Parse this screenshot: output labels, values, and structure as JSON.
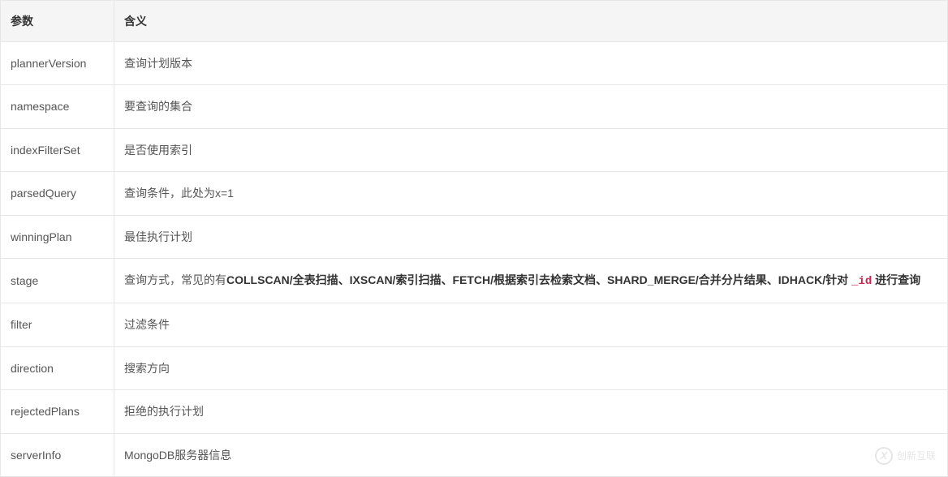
{
  "table": {
    "headers": {
      "param": "参数",
      "meaning": "含义"
    },
    "rows": [
      {
        "param": "plannerVersion",
        "meaning": "查询计划版本"
      },
      {
        "param": "namespace",
        "meaning": "要查询的集合"
      },
      {
        "param": "indexFilterSet",
        "meaning": "是否使用索引"
      },
      {
        "param": "parsedQuery",
        "meaning": "查询条件，此处为x=1"
      },
      {
        "param": "winningPlan",
        "meaning": "最佳执行计划"
      },
      {
        "param": "stage",
        "meaning_parts": {
          "prefix": "查询方式，常见的有",
          "bold1": "COLLSCAN/全表扫描、IXSCAN/索引扫描、FETCH/根据索引去检索文档、SHARD_MERGE/合并分片结果、IDHACK/针对 ",
          "code": "_id",
          "bold2": " 进行查询"
        }
      },
      {
        "param": "filter",
        "meaning": "过滤条件"
      },
      {
        "param": "direction",
        "meaning": "搜索方向"
      },
      {
        "param": "rejectedPlans",
        "meaning": "拒绝的执行计划"
      },
      {
        "param": "serverInfo",
        "meaning": "MongoDB服务器信息"
      }
    ]
  },
  "watermark": {
    "icon_text": "X",
    "text": "创新互联"
  }
}
